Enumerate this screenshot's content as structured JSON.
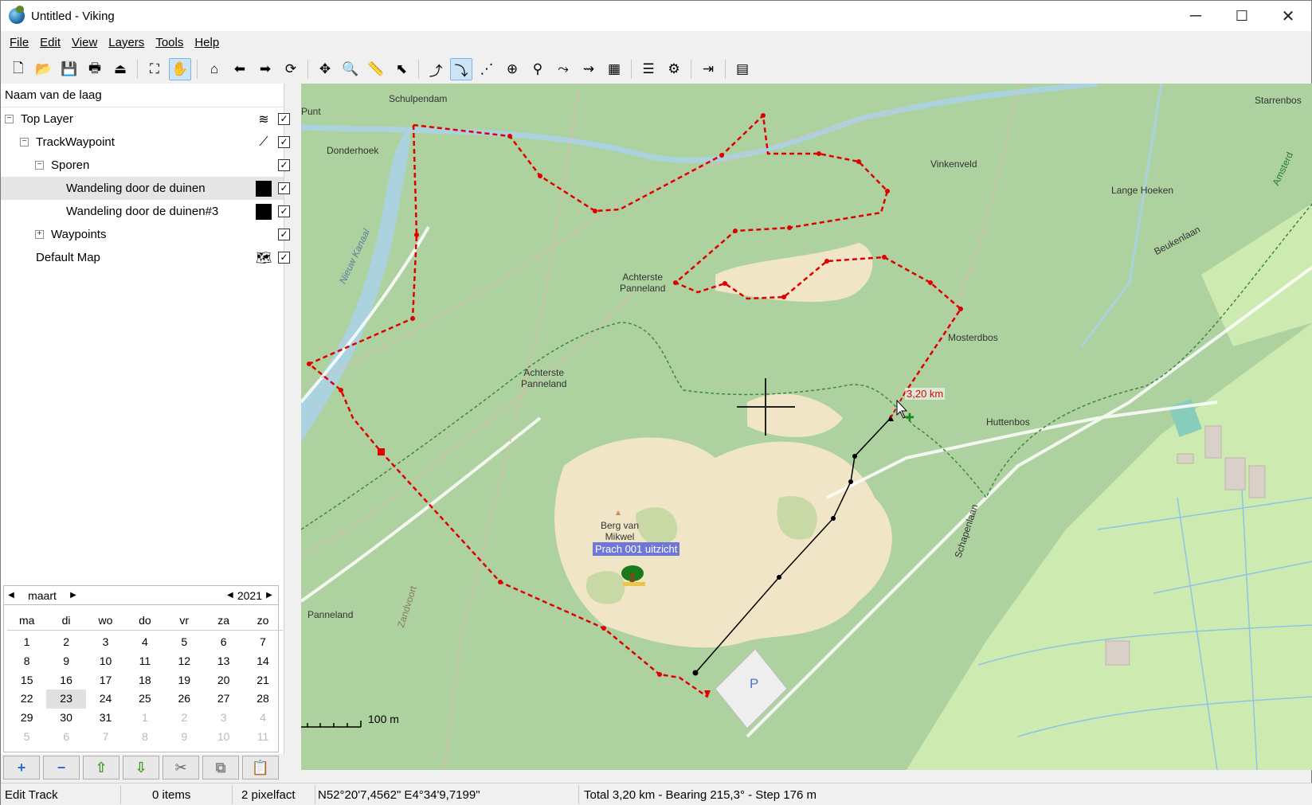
{
  "window": {
    "title": "Untitled - Viking",
    "minimize": "─",
    "maximize": "☐",
    "close": "✕"
  },
  "menu": [
    {
      "label": "File",
      "name": "menu-file"
    },
    {
      "label": "Edit",
      "name": "menu-edit"
    },
    {
      "label": "View",
      "name": "menu-view"
    },
    {
      "label": "Layers",
      "name": "menu-layers"
    },
    {
      "label": "Tools",
      "name": "menu-tools"
    },
    {
      "label": "Help",
      "name": "menu-help"
    }
  ],
  "toolbar": [
    {
      "icon": "new-file-icon",
      "glyph": "🗋"
    },
    {
      "icon": "open-folder-icon",
      "glyph": "📂"
    },
    {
      "icon": "save-icon",
      "glyph": "💾"
    },
    {
      "icon": "print-icon",
      "glyph": "🖶"
    },
    {
      "icon": "exit-icon",
      "glyph": "⏏"
    },
    {
      "sep": true
    },
    {
      "icon": "fullscreen-icon",
      "glyph": "⛶"
    },
    {
      "icon": "pan-hand-icon",
      "glyph": "✋",
      "active": true
    },
    {
      "sep": true
    },
    {
      "icon": "home-icon",
      "glyph": "⌂"
    },
    {
      "icon": "back-arrow-icon",
      "glyph": "⬅"
    },
    {
      "icon": "forward-arrow-icon",
      "glyph": "➡"
    },
    {
      "icon": "refresh-icon",
      "glyph": "⟳"
    },
    {
      "sep": true
    },
    {
      "icon": "move-icon",
      "glyph": "✥"
    },
    {
      "icon": "zoom-icon",
      "glyph": "🔍"
    },
    {
      "icon": "ruler-icon",
      "glyph": "📏"
    },
    {
      "icon": "select-arrow-icon",
      "glyph": "⬉"
    },
    {
      "sep": true
    },
    {
      "icon": "create-track-icon",
      "glyph": "⤴"
    },
    {
      "icon": "edit-track-icon",
      "glyph": "⤵",
      "active": true
    },
    {
      "icon": "edit-trackpoint-icon",
      "glyph": "⋰"
    },
    {
      "icon": "create-waypoint-icon",
      "glyph": "⊕"
    },
    {
      "icon": "edit-waypoint-icon",
      "glyph": "⚲"
    },
    {
      "icon": "route-finder-icon",
      "glyph": "⤳"
    },
    {
      "icon": "extend-track-icon",
      "glyph": "⇝"
    },
    {
      "icon": "download-maps-icon",
      "glyph": "▦"
    },
    {
      "sep": true
    },
    {
      "icon": "layer-properties-icon",
      "glyph": "☰"
    },
    {
      "icon": "layer-tool-icon",
      "glyph": "⚙"
    },
    {
      "sep": true
    },
    {
      "icon": "export-icon",
      "glyph": "⇥"
    },
    {
      "sep": true
    },
    {
      "icon": "dock-icon",
      "glyph": "▤"
    }
  ],
  "tree": {
    "header": "Naam van de laag",
    "rows": [
      {
        "label": "Top Layer",
        "level": 0,
        "expander": "−",
        "icon": "layers-stack-icon",
        "glyph": "≋",
        "checked": true
      },
      {
        "label": "TrackWaypoint",
        "level": 1,
        "expander": "−",
        "icon": "track-waypoint-icon",
        "glyph": "⟋",
        "checked": true
      },
      {
        "label": "Sporen",
        "level": 2,
        "expander": "−",
        "checked": true
      },
      {
        "label": "Wandeling door de duinen",
        "level": 3,
        "swatch": true,
        "checked": true,
        "selected": true
      },
      {
        "label": "Wandeling door de duinen#3",
        "level": 3,
        "swatch": true,
        "checked": true
      },
      {
        "label": "Waypoints",
        "level": 2,
        "expander": "+",
        "checked": true
      },
      {
        "label": "Default Map",
        "level": 1,
        "icon": "map-icon",
        "glyph": "🗺",
        "checked": true
      }
    ]
  },
  "calendar": {
    "month": "maart",
    "year": "2021",
    "days_of_week": [
      "ma",
      "di",
      "wo",
      "do",
      "vr",
      "za",
      "zo"
    ],
    "today": "23",
    "weeks": [
      [
        "1",
        "2",
        "3",
        "4",
        "5",
        "6",
        "7"
      ],
      [
        "8",
        "9",
        "10",
        "11",
        "12",
        "13",
        "14"
      ],
      [
        "15",
        "16",
        "17",
        "18",
        "19",
        "20",
        "21"
      ],
      [
        "22",
        "23",
        "24",
        "25",
        "26",
        "27",
        "28"
      ],
      [
        "29",
        "30",
        "31",
        "1",
        "2",
        "3",
        "4"
      ],
      [
        "5",
        "6",
        "7",
        "8",
        "9",
        "10",
        "11"
      ]
    ]
  },
  "bottom_buttons": [
    {
      "name": "add-layer-button",
      "glyph": "+",
      "color": "#2d6fd6"
    },
    {
      "name": "remove-layer-button",
      "glyph": "−",
      "color": "#2d6fd6"
    },
    {
      "name": "move-up-button",
      "glyph": "⇧",
      "color": "#3a9a22"
    },
    {
      "name": "move-down-button",
      "glyph": "⇩",
      "color": "#3a9a22"
    },
    {
      "name": "cut-button",
      "glyph": "✂",
      "color": "#666"
    },
    {
      "name": "copy-button",
      "glyph": "⧉",
      "color": "#888"
    },
    {
      "name": "paste-button",
      "glyph": "📋",
      "color": "#555"
    }
  ],
  "map": {
    "labels": {
      "schulpendam": "Schulpendam",
      "punt": "Punt",
      "donderhoek": "Donderhoek",
      "vinkenveld": "Vinkenveld",
      "starrenbos": "Starrenbos",
      "lange_hoeken": "Lange Hoeken",
      "beukenlaan": "Beukenlaan",
      "achterste_panneland_1": "Achterste\nPanneland",
      "achterste_panneland_2": "Achterste\nPanneland",
      "mosterdbos": "Mosterdbos",
      "huttenbos": "Huttenbos",
      "nieuw_kanaal": "Nieuw Kanaal",
      "berg_van_mikwel": "Berg van\nMikwel",
      "panneland": "Panneland",
      "zandvoort": "Zandvoort",
      "schapenlaan": "Schapenlaan",
      "amsterdam": "Amsterd",
      "parking": "P"
    },
    "distance_label": "3,20 km",
    "waypoint_label": "Prach 001 uitzicht",
    "scale_label": "100 m",
    "colors": {
      "track": "#e00000",
      "path_green": "#3c8a3c",
      "water": "#aad3df",
      "forest": "#add19e",
      "dune": "#f1e5c8",
      "grass": "#cdebb0"
    }
  },
  "status": {
    "mode": "Edit Track",
    "items": "0 items",
    "zoom": "2 pixelfact",
    "coordinates": "N52°20'7,4562\" E4°34'9,7199\"",
    "info": "Total 3,20 km - Bearing 215,3° - Step 176 m"
  }
}
